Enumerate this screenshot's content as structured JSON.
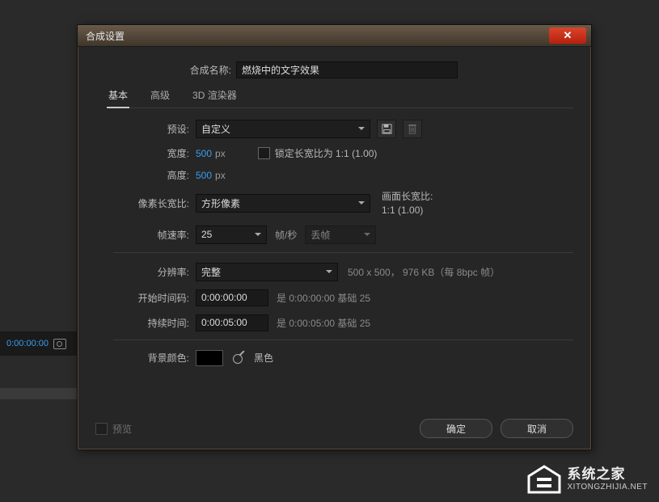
{
  "dialog": {
    "title": "合成设置",
    "name_label": "合成名称:",
    "name_value": "燃烧中的文字效果",
    "tabs": {
      "basic": "基本",
      "advanced": "高级",
      "renderer": "3D 渲染器"
    },
    "preset_label": "预设:",
    "preset_value": "自定义",
    "width_label": "宽度:",
    "width_value": "500",
    "width_unit": "px",
    "height_label": "高度:",
    "height_value": "500",
    "height_unit": "px",
    "lock_label": "锁定长宽比为 1:1 (1.00)",
    "par_label": "像素长宽比:",
    "par_value": "方形像素",
    "frame_aspect_label": "画面长宽比:",
    "frame_aspect_value": "1:1 (1.00)",
    "fps_label": "帧速率:",
    "fps_value": "25",
    "fps_unit": "帧/秒",
    "dropframe": "丢帧",
    "res_label": "分辨率:",
    "res_value": "完整",
    "res_info": "500 x 500， 976 KB（每 8bpc 帧）",
    "start_label": "开始时间码:",
    "start_value": "0:00:00:00",
    "start_info": "是 0:00:00:00  基础 25",
    "dur_label": "持续时间:",
    "dur_value": "0:00:05:00",
    "dur_info": "是 0:00:05:00  基础 25",
    "bg_label": "背景颜色:",
    "bg_name": "黑色",
    "preview": "预览",
    "ok": "确定",
    "cancel": "取消"
  },
  "bg": {
    "timecode": "0:00:00:00"
  },
  "watermark": {
    "cn": "系统之家",
    "en": "XITONGZHIJIA.NET"
  }
}
